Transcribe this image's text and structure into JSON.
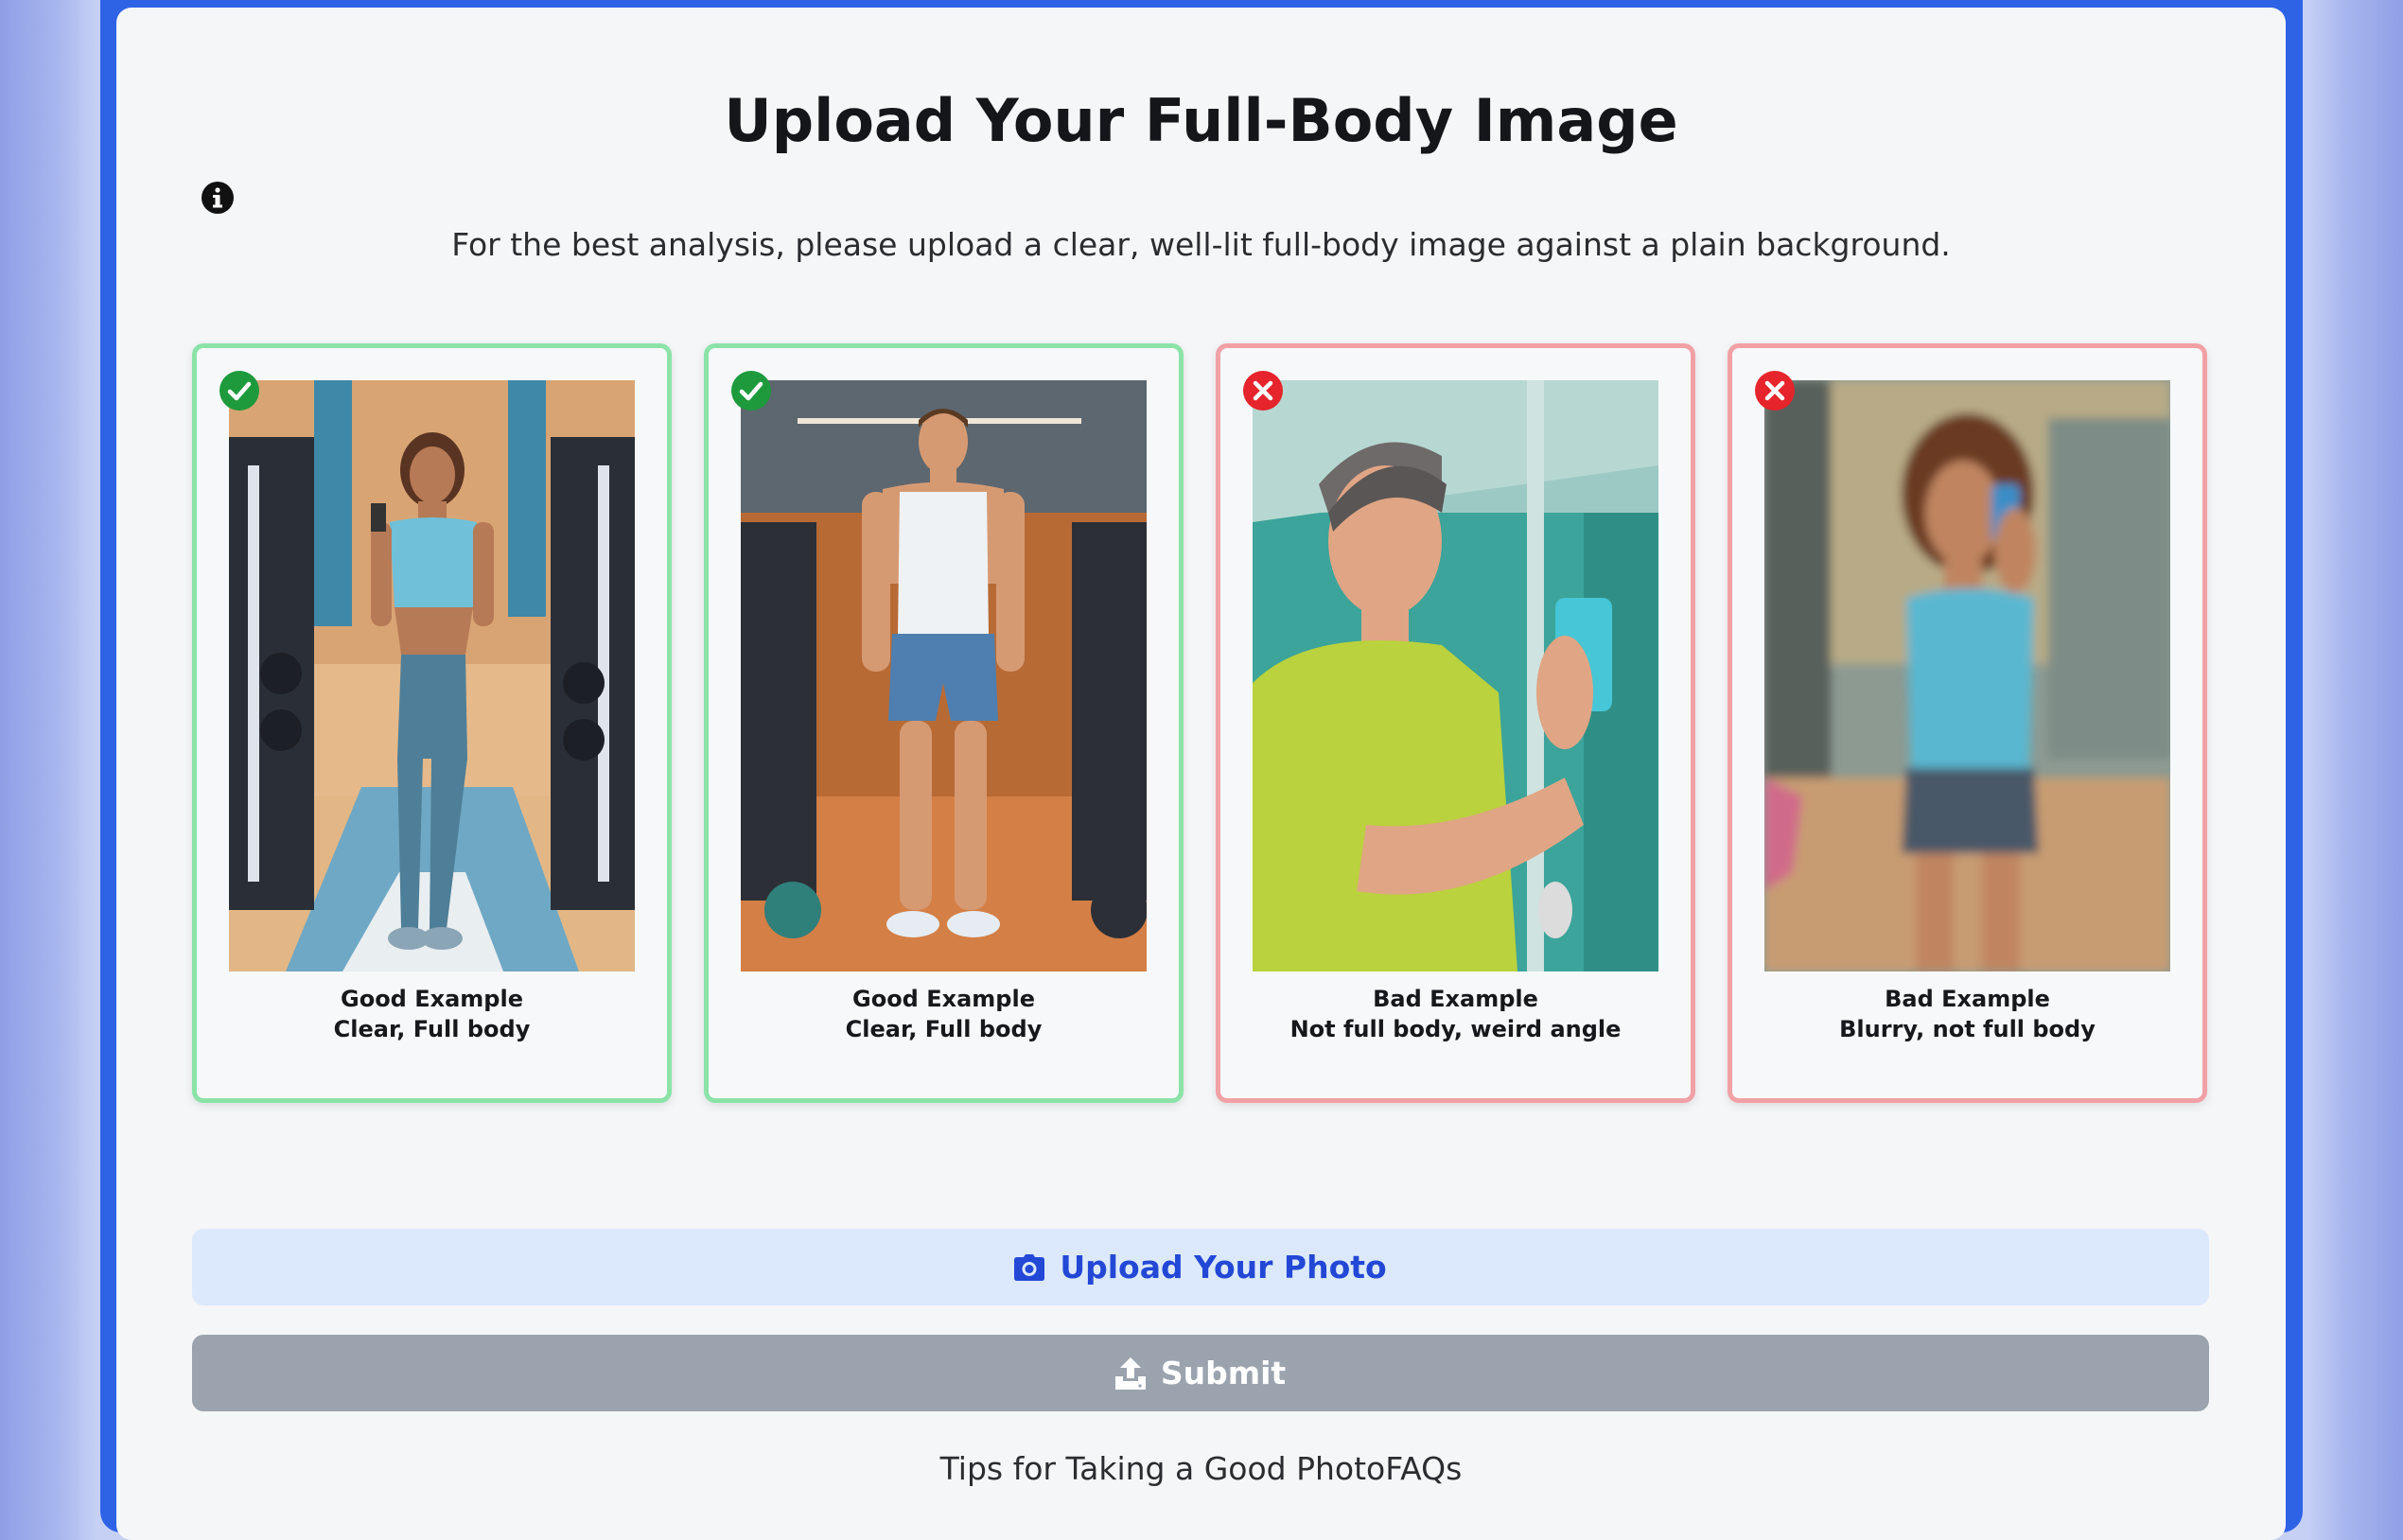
{
  "page": {
    "title": "Upload Your Full-Body Image",
    "subtitle": "For the best analysis, please upload a clear, well-lit full-body image against a plain background."
  },
  "examples": [
    {
      "status": "good",
      "label": "Good Example",
      "caption": "Clear, Full body",
      "icon": "check-icon"
    },
    {
      "status": "good",
      "label": "Good Example",
      "caption": "Clear, Full body",
      "icon": "check-icon"
    },
    {
      "status": "bad",
      "label": "Bad Example",
      "caption": "Not full body, weird angle",
      "icon": "x-icon"
    },
    {
      "status": "bad",
      "label": "Bad Example",
      "caption": "Blurry, not full body",
      "icon": "x-icon"
    }
  ],
  "actions": {
    "upload_label": "Upload Your Photo",
    "upload_icon": "camera-icon",
    "submit_label": "Submit",
    "submit_icon": "upload-icon"
  },
  "footer": {
    "tips_link": "Tips for Taking a Good Photo",
    "faqs_link": "FAQs"
  },
  "colors": {
    "frame": "#2f63e6",
    "good_border": "#8be3a8",
    "bad_border": "#f1a1a5",
    "good_badge": "#1e9a3c",
    "bad_badge": "#e5242b",
    "upload_bg": "#dce9fd",
    "upload_text": "#2348d6",
    "submit_bg": "#9aa3ae"
  }
}
